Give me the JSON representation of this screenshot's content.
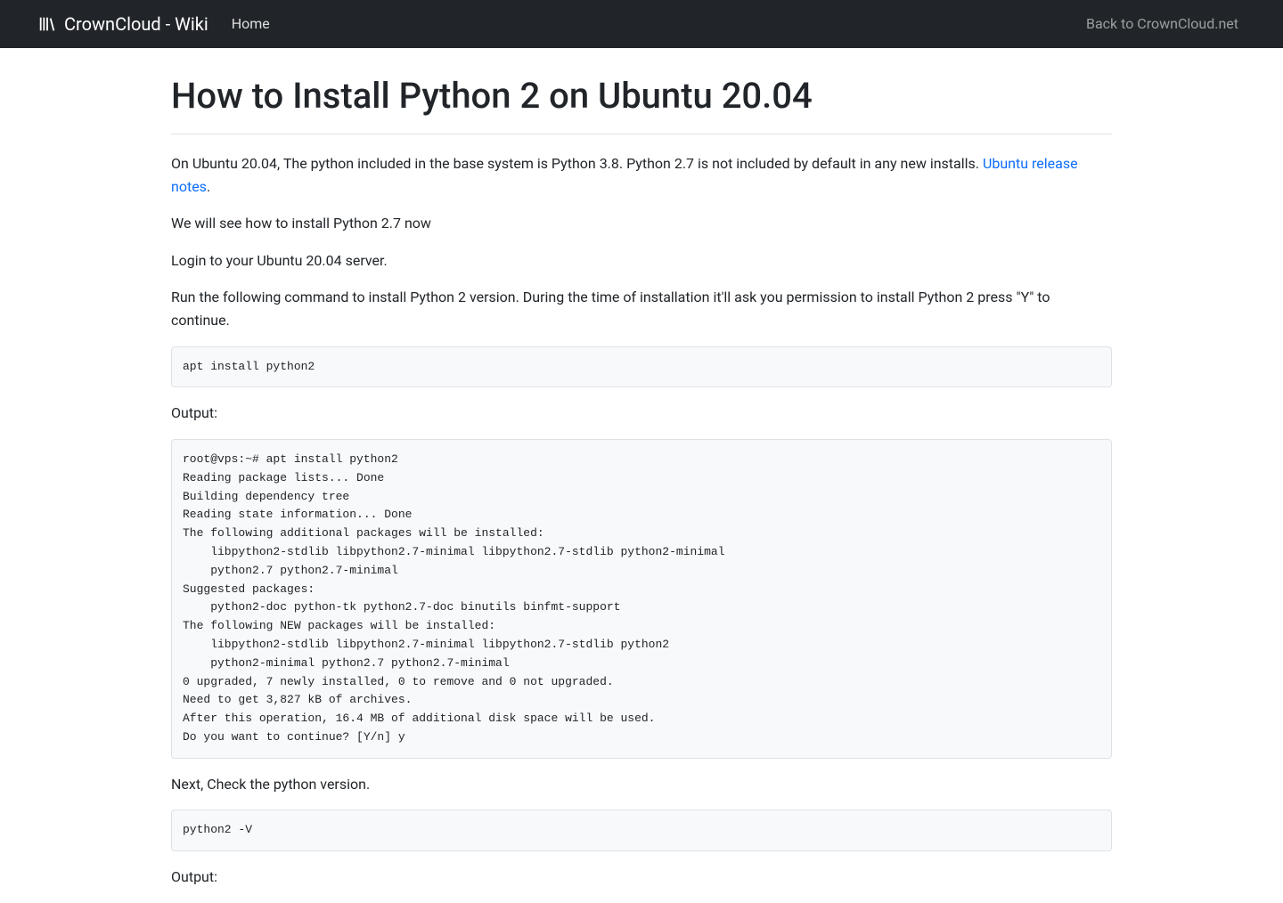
{
  "navbar": {
    "brand": "CrownCloud - Wiki",
    "home": "Home",
    "back_link": "Back to CrownCloud.net"
  },
  "article": {
    "title": "How to Install Python 2 on Ubuntu 20.04",
    "intro_pre": "On Ubuntu 20.04, The python included in the base system is Python 3.8. Python 2.7 is not included by default in any new installs. ",
    "intro_link": "Ubuntu release notes",
    "intro_post": ".",
    "p2": "We will see how to install Python 2.7 now",
    "p3": "Login to your Ubuntu 20.04 server.",
    "p4": "Run the following command to install Python 2 version. During the time of installation it'll ask you permission to install Python 2 press \"Y\" to continue.",
    "code1": "apt install python2",
    "output_label_1": "Output:",
    "code2": "root@vps:~# apt install python2\nReading package lists... Done\nBuilding dependency tree\nReading state information... Done\nThe following additional packages will be installed:\n    libpython2-stdlib libpython2.7-minimal libpython2.7-stdlib python2-minimal\n    python2.7 python2.7-minimal\nSuggested packages:\n    python2-doc python-tk python2.7-doc binutils binfmt-support\nThe following NEW packages will be installed:\n    libpython2-stdlib libpython2.7-minimal libpython2.7-stdlib python2\n    python2-minimal python2.7 python2.7-minimal\n0 upgraded, 7 newly installed, 0 to remove and 0 not upgraded.\nNeed to get 3,827 kB of archives.\nAfter this operation, 16.4 MB of additional disk space will be used.\nDo you want to continue? [Y/n] y",
    "p5": "Next, Check the python version.",
    "code3": "python2 -V",
    "output_label_2": "Output:"
  }
}
